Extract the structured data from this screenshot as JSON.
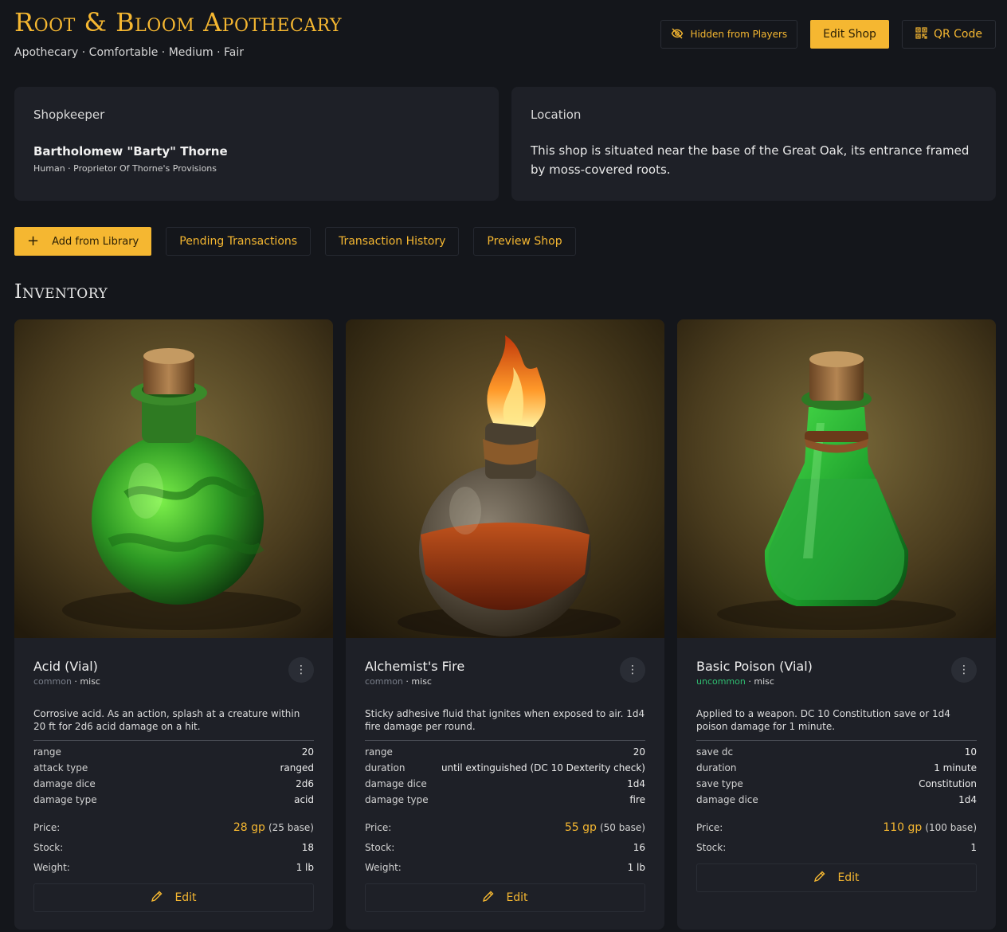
{
  "header": {
    "title": "Root & Bloom Apothecary",
    "subtitle": "Apothecary · Comfortable · Medium · Fair",
    "visibility_label": "Hidden from Players",
    "edit_label": "Edit Shop",
    "qr_label": "QR Code"
  },
  "shopkeeper": {
    "label": "Shopkeeper",
    "name": "Bartholomew \"Barty\" Thorne",
    "meta": "Human · Proprietor Of Thorne's Provisions"
  },
  "location": {
    "label": "Location",
    "text": "This shop is situated near the base of the Great Oak, its entrance framed by moss-covered roots."
  },
  "actions": {
    "add_label": "Add from Library",
    "pending_label": "Pending Transactions",
    "history_label": "Transaction History",
    "preview_label": "Preview Shop"
  },
  "inventory": {
    "title": "Inventory",
    "price_label": "Price:",
    "stock_label": "Stock:",
    "weight_label": "Weight:",
    "edit_label": "Edit",
    "items": [
      {
        "name": "Acid (Vial)",
        "rarity": "common",
        "type": "misc",
        "description": "Corrosive acid. As an action, splash at a creature within 20 ft for 2d6 acid damage on a hit.",
        "props": [
          {
            "key": "range",
            "value": "20"
          },
          {
            "key": "attack type",
            "value": "ranged"
          },
          {
            "key": "damage dice",
            "value": "2d6"
          },
          {
            "key": "damage type",
            "value": "acid"
          }
        ],
        "price": "28 gp",
        "base": "(25 base)",
        "stock": "18",
        "weight": "1 lb",
        "image_icon": "green-round-flask-image"
      },
      {
        "name": "Alchemist's Fire",
        "rarity": "common",
        "type": "misc",
        "description": "Sticky adhesive fluid that ignites when exposed to air. 1d4 fire damage per round.",
        "props": [
          {
            "key": "range",
            "value": "20"
          },
          {
            "key": "duration",
            "value": "until extinguished (DC 10 Dexterity check)"
          },
          {
            "key": "damage dice",
            "value": "1d4"
          },
          {
            "key": "damage type",
            "value": "fire"
          }
        ],
        "price": "55 gp",
        "base": "(50 base)",
        "stock": "16",
        "weight": "1 lb",
        "image_icon": "flaming-flask-image"
      },
      {
        "name": "Basic Poison (Vial)",
        "rarity": "uncommon",
        "type": "misc",
        "description": "Applied to a weapon. DC 10 Constitution save or 1d4 poison damage for 1 minute.",
        "props": [
          {
            "key": "save dc",
            "value": "10"
          },
          {
            "key": "duration",
            "value": "1 minute"
          },
          {
            "key": "save type",
            "value": "Constitution"
          },
          {
            "key": "damage dice",
            "value": "1d4"
          }
        ],
        "price": "110 gp",
        "base": "(100 base)",
        "stock": "1",
        "weight": "",
        "image_icon": "green-conical-flask-image"
      }
    ]
  },
  "colors": {
    "accent": "#f5b731",
    "background": "#14161b",
    "card": "#1e2027",
    "uncommon": "#2fbf71",
    "common": "#7a7f8a"
  }
}
